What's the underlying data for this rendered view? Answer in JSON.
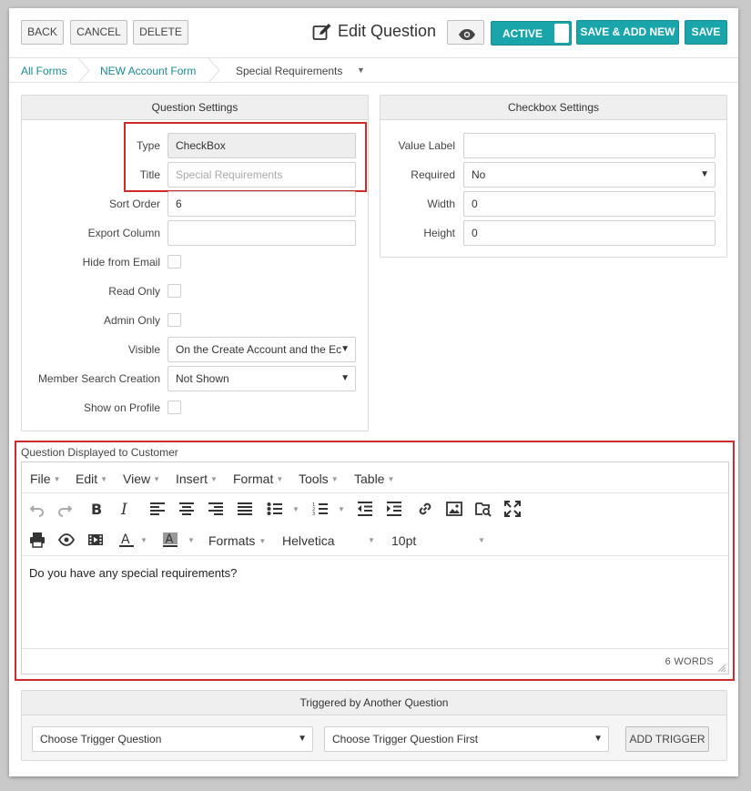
{
  "toolbar": {
    "back_label": "BACK",
    "cancel_label": "CANCEL",
    "delete_label": "DELETE",
    "page_title": "Edit Question",
    "preview_icon": "eye-icon",
    "active_label": "ACTIVE",
    "save_add_new_label": "SAVE & ADD NEW",
    "save_label": "SAVE"
  },
  "breadcrumb": {
    "items": [
      "All Forms",
      "NEW Account Form",
      "Special Requirements"
    ]
  },
  "question_settings": {
    "title": "Question Settings",
    "type_label": "Type",
    "type_value": "CheckBox",
    "title_label": "Title",
    "title_placeholder": "Special Requirements",
    "sort_order_label": "Sort Order",
    "sort_order_value": "6",
    "export_column_label": "Export Column",
    "export_column_value": "",
    "hide_email_label": "Hide from Email",
    "read_only_label": "Read Only",
    "admin_only_label": "Admin Only",
    "visible_label": "Visible",
    "visible_value": "On the Create Account and the Ec",
    "member_search_label": "Member Search Creation",
    "member_search_value": "Not Shown",
    "show_profile_label": "Show on Profile"
  },
  "checkbox_settings": {
    "title": "Checkbox Settings",
    "value_label_label": "Value Label",
    "value_label_value": "",
    "required_label": "Required",
    "required_value": "No",
    "width_label": "Width",
    "width_value": "0",
    "height_label": "Height",
    "height_value": "0"
  },
  "editor": {
    "label": "Question Displayed to Customer",
    "menus": [
      "File",
      "Edit",
      "View",
      "Insert",
      "Format",
      "Tools",
      "Table"
    ],
    "formats_label": "Formats",
    "font_family": "Helvetica",
    "font_size": "10pt",
    "content": "Do you have any special requirements?",
    "word_count": "6 WORDS"
  },
  "trigger": {
    "title": "Triggered by Another Question",
    "question_value": "Choose Trigger Question",
    "answer_value": "Choose Trigger Question First",
    "add_label": "ADD TRIGGER"
  },
  "colors": {
    "accent": "#1aa5ab",
    "highlight": "#d12a2a",
    "link": "#1a8a8f"
  }
}
